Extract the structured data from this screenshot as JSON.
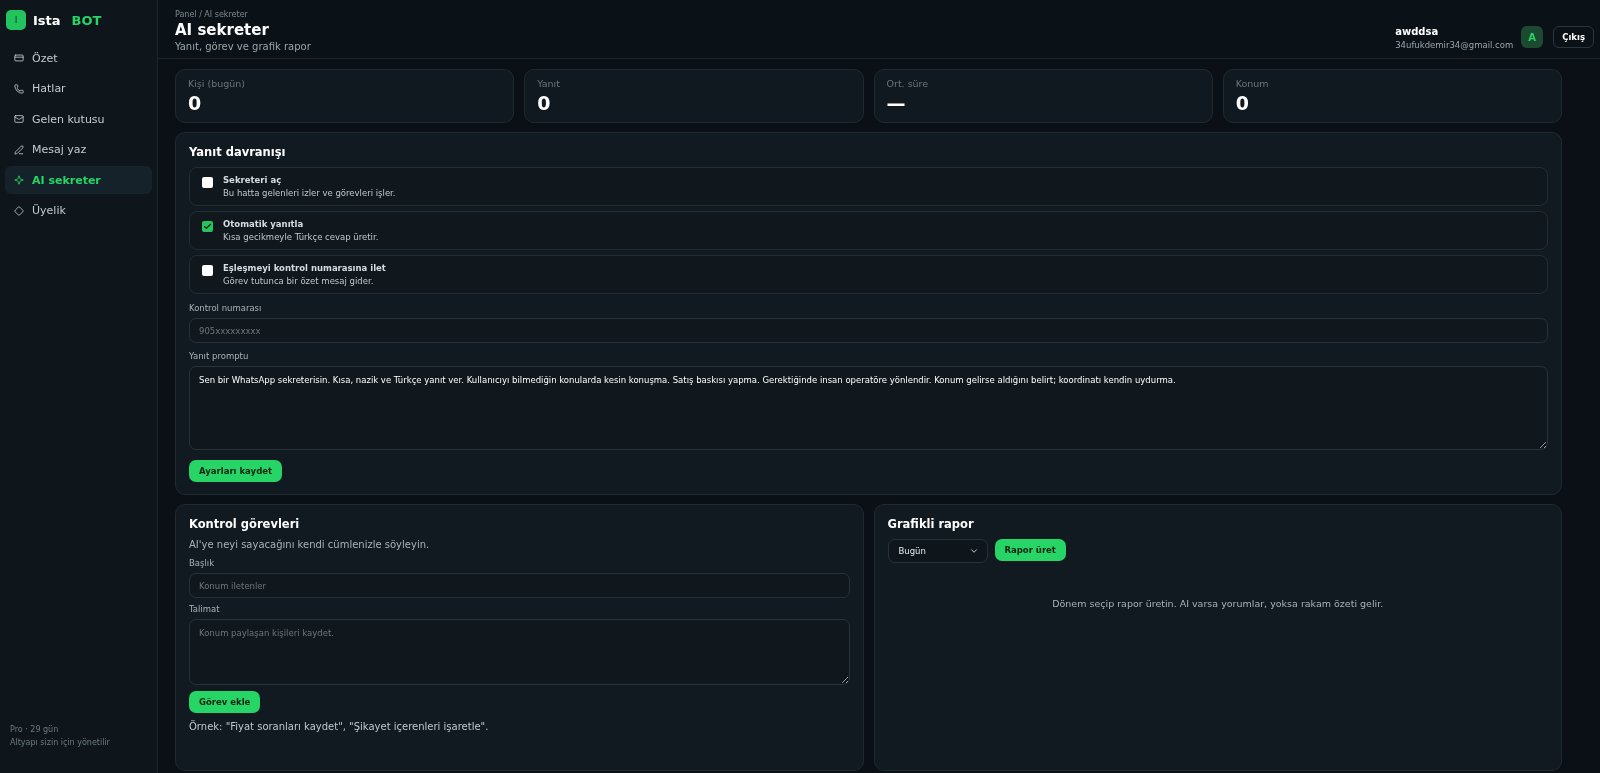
{
  "brand": {
    "logo_letter": "I",
    "name": "Ista",
    "accent": "BOT"
  },
  "sidebar": {
    "items": [
      {
        "label": "Özet",
        "selected": false
      },
      {
        "label": "Hatlar",
        "selected": false
      },
      {
        "label": "Gelen kutusu",
        "selected": false
      },
      {
        "label": "Mesaj yaz",
        "selected": false
      },
      {
        "label": "AI sekreter",
        "selected": true
      },
      {
        "label": "Üyelik",
        "selected": false
      }
    ],
    "footer": [
      "Pro · 29 gün",
      "Altyapı sizin için yönetilir"
    ]
  },
  "header": {
    "breadcrumb": "Panel / AI sekreter",
    "title": "AI sekreter",
    "subtitle": "Yanıt, görev ve grafik rapor",
    "user_name": "awddsa",
    "user_email": "34ufukdemir34@gmail.com",
    "avatar": "A",
    "logout": "Çıkış"
  },
  "stats": [
    {
      "label": "Kişi (bugün)",
      "value": "0"
    },
    {
      "label": "Yanıt",
      "value": "0"
    },
    {
      "label": "Ort. süre",
      "value": "—"
    },
    {
      "label": "Konum",
      "value": "0"
    }
  ],
  "behavior": {
    "title": "Yanıt davranışı",
    "options": [
      {
        "title": "Sekreteri aç",
        "desc": "Bu hatta gelenleri izler ve görevleri işler.",
        "checked": false
      },
      {
        "title": "Otomatik yanıtla",
        "desc": "Kısa gecikmeyle Türkçe cevap üretir.",
        "checked": true
      },
      {
        "title": "Eşleşmeyi kontrol numarasına ilet",
        "desc": "Görev tutunca bir özet mesaj gider.",
        "checked": false
      }
    ],
    "number_label": "Kontrol numarası",
    "number_placeholder": "905xxxxxxxxx",
    "prompt_label": "Yanıt promptu",
    "prompt_value": "Sen bir WhatsApp sekreterisin. Kısa, nazik ve Türkçe yanıt ver. Kullanıcıyı bilmediğin konularda kesin konuşma. Satış baskısı yapma. Gerektiğinde insan operatöre yönlendir. Konum gelirse aldığını belirt; koordinatı kendin uydurma.",
    "save": "Ayarları kaydet"
  },
  "tasks": {
    "title": "Kontrol görevleri",
    "desc": "AI'ye neyi sayacağını kendi cümlenizle söyleyin.",
    "title_label": "Başlık",
    "title_placeholder": "Konum iletenler",
    "instruction_label": "Talimat",
    "instruction_placeholder": "Konum paylaşan kişileri kaydet.",
    "add": "Görev ekle",
    "example": "Örnek: \"Fiyat soranları kaydet\", \"Şikayet içerenleri işaretle\"."
  },
  "report": {
    "title": "Grafikli rapor",
    "period": "Bugün",
    "generate": "Rapor üret",
    "empty": "Dönem seçip rapor üretin. AI varsa yorumlar, yoksa rakam özeti gelir."
  }
}
